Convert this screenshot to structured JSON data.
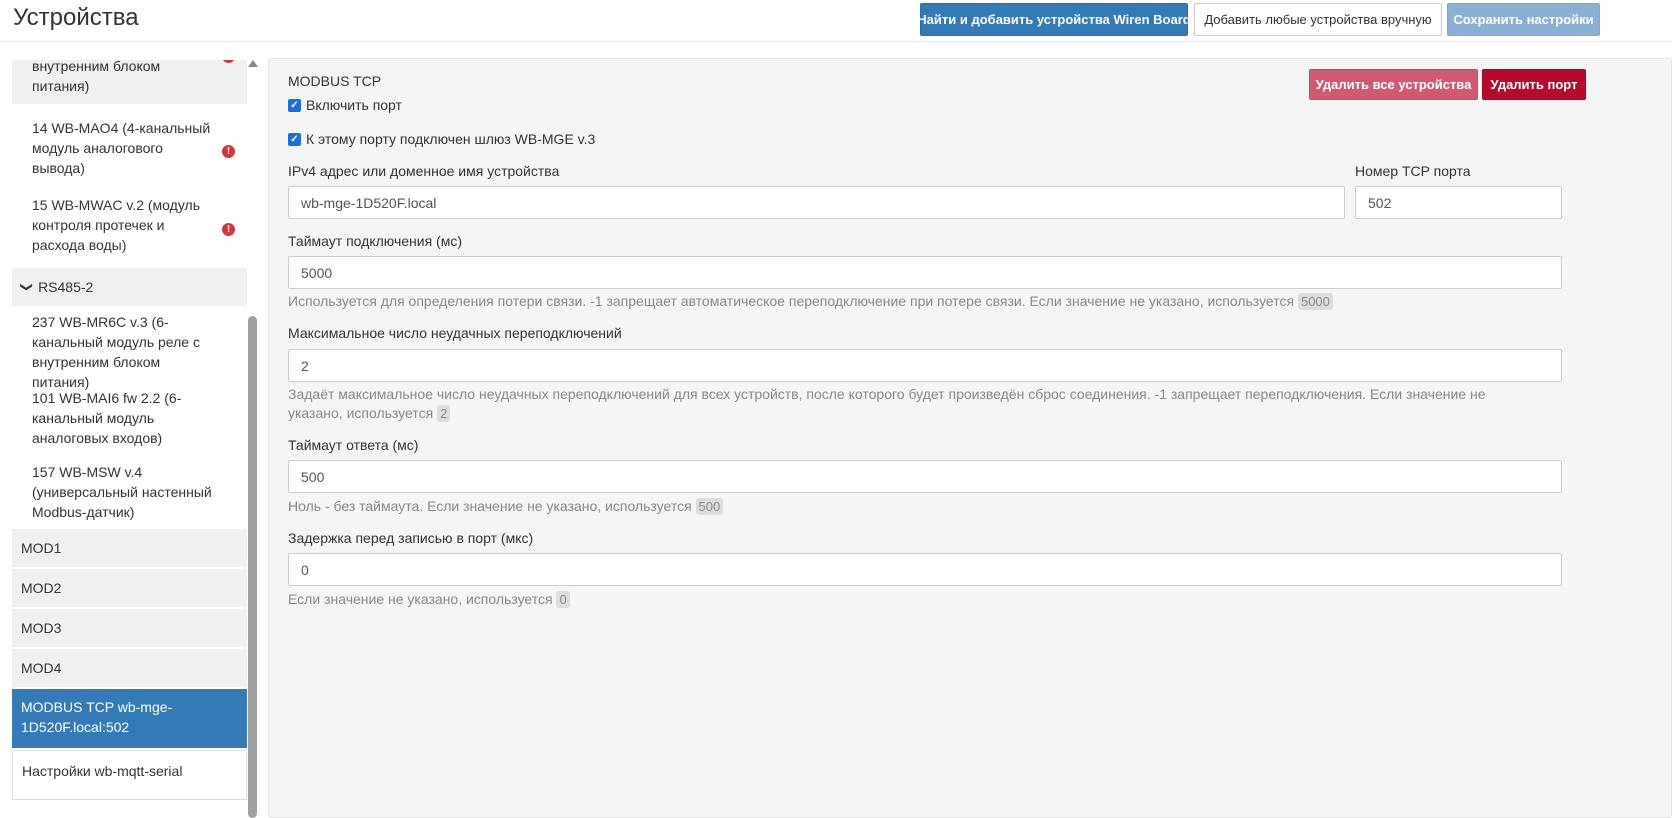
{
  "header": {
    "title": "Устройства",
    "find_button": "Найти и добавить устройства Wiren Board",
    "add_manual_button": "Добавить любые устройства вручную",
    "save_button": "Сохранить настройки"
  },
  "sidebar": {
    "items": [
      {
        "kind": "device",
        "label": "внутренним блоком питания)",
        "error": true,
        "grey": true
      },
      {
        "kind": "device",
        "label": "14 WB-MAO4 (4-канальный модуль аналогового вывода)",
        "error": true
      },
      {
        "kind": "device",
        "label": "15 WB-MWAC v.2 (модуль контроля протечек и расхода воды)",
        "error": true
      },
      {
        "kind": "group",
        "label": "RS485-2"
      },
      {
        "kind": "device",
        "label": "237 WB-MR6C v.3 (6-канальный модуль реле с внутренним блоком питания)"
      },
      {
        "kind": "device",
        "label": "101 WB-MAI6 fw 2.2 (6-канальный модуль аналоговых входов)"
      },
      {
        "kind": "device",
        "label": "157 WB-MSW v.4 (универсальный настенный Modbus-датчик)"
      },
      {
        "kind": "port",
        "label": "MOD1"
      },
      {
        "kind": "port",
        "label": "MOD2"
      },
      {
        "kind": "port",
        "label": "MOD3"
      },
      {
        "kind": "port",
        "label": "MOD4"
      },
      {
        "kind": "active",
        "label": "MODBUS TCP wb-mge-1D520F.local:502"
      },
      {
        "kind": "settings",
        "label": "Настройки wb-mqtt-serial"
      }
    ],
    "error_glyph": "!",
    "chevron_glyph": "❯"
  },
  "main": {
    "port_title": "MODBUS TCP",
    "delete_all_button": "Удалить все устройства",
    "delete_port_button": "Удалить порт",
    "enable_port": {
      "label": "Включить порт",
      "checked": true
    },
    "gateway": {
      "label": "К этому порту подключен шлюз WB-MGE v.3",
      "checked": true
    },
    "address": {
      "label": "IPv4 адрес или доменное имя устройства",
      "value": "wb-mge-1D520F.local"
    },
    "tcp_port": {
      "label": "Номер TCP порта",
      "value": "502"
    },
    "connection_timeout": {
      "label": "Таймаут подключения (мс)",
      "value": "5000",
      "help": "Используется для определения потери связи. -1 запрещает автоматическое переподключение при потере связи. Если значение не указано, используется",
      "default": "5000"
    },
    "max_failures": {
      "label": "Максимальное число неудачных переподключений",
      "value": "2",
      "help": "Задаёт максимальное число неудачных переподключений для всех устройств, после которого будет произведён сброс соединения. -1 запрещает переподключения. Если значение не указано, используется",
      "default": "2"
    },
    "response_timeout": {
      "label": "Таймаут ответа (мс)",
      "value": "500",
      "help": "Ноль - без таймаута. Если значение не указано, используется",
      "default": "500"
    },
    "write_delay": {
      "label": "Задержка перед записью в порт (мкс)",
      "value": "0",
      "help": "Если значение не указано, используется",
      "default": "0"
    }
  },
  "colors": {
    "primary": "#337ab7",
    "danger": "#b5092e",
    "danger_light": "#cf5a72",
    "error_icon": "#d9333f",
    "panel_bg": "#f5f5f5"
  }
}
